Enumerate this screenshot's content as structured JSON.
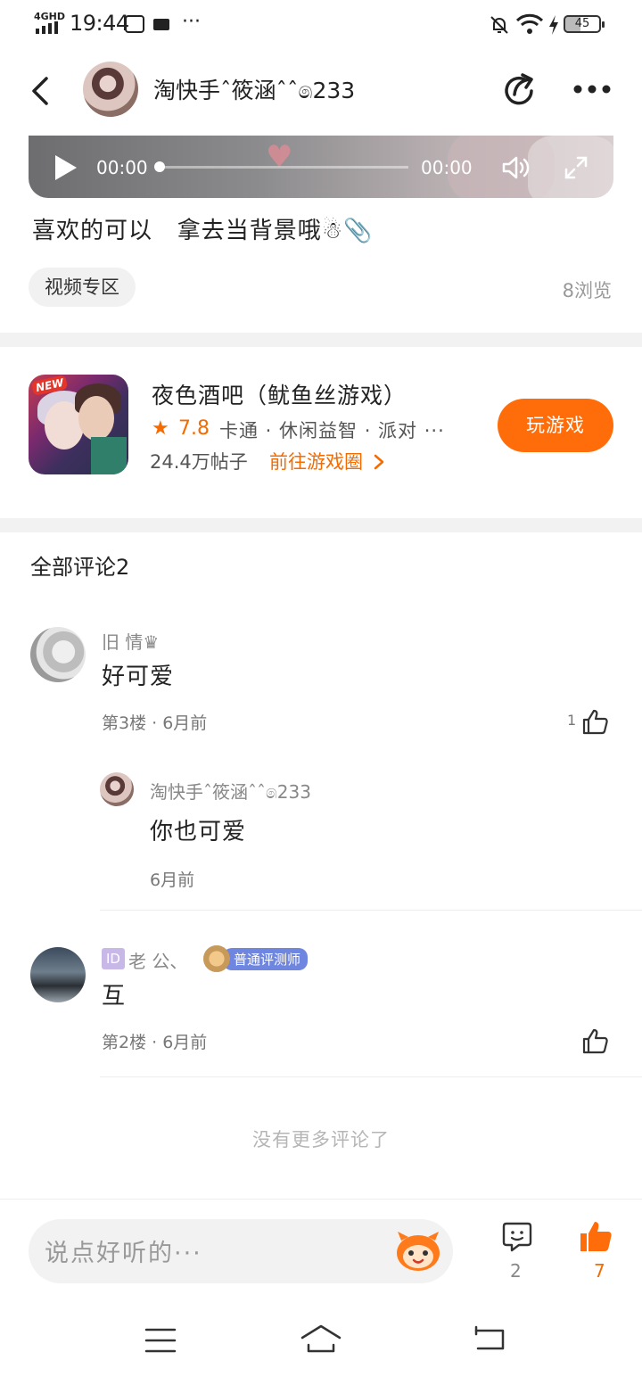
{
  "status_bar": {
    "network": "4GHD",
    "time": "19:44",
    "more": "···",
    "battery": "45"
  },
  "header": {
    "username": "淘快手ˆ筱涵ˆˆ෧233"
  },
  "player": {
    "time_current": "00:00",
    "time_total": "00:00",
    "progress": 0
  },
  "post": {
    "caption": "喜欢的可以   拿去当背景哦☃📎",
    "tag": "视频专区",
    "views": "8浏览"
  },
  "game": {
    "badge": "NEW",
    "title": "夜色酒吧（鱿鱼丝游戏）",
    "rating": "7.8",
    "tags": "卡通 · 休闲益智 · 派对 ···",
    "posts": "24.4万帖子",
    "circle_link": "前往游戏圈",
    "play_button": "玩游戏"
  },
  "comments": {
    "title": "全部评论2",
    "items": [
      {
        "name": "旧  情♛",
        "text": "好可爱",
        "meta": "第3楼 · 6月前",
        "likes": "1",
        "reply": {
          "name": "淘快手ˆ筱涵ˆˆ෧233",
          "text": "你也可爱",
          "meta": "6月前"
        }
      },
      {
        "id_badge": "ID",
        "name": "老   公、",
        "role_badge": "普通评测师",
        "text": "互",
        "meta": "第2楼 · 6月前"
      }
    ],
    "no_more": "没有更多评论了"
  },
  "bottom_bar": {
    "input_placeholder": "说点好听的···",
    "comment_count": "2",
    "like_count": "7"
  },
  "colors": {
    "accent": "#ff6d0a",
    "separator": "#f2f2f2",
    "muted": "#999999"
  },
  "icons": [
    "back-arrow-icon",
    "share-icon",
    "more-dots-icon",
    "play-icon",
    "volume-icon",
    "fullscreen-icon",
    "star-icon",
    "chevron-right-icon",
    "thumb-up-icon",
    "comment-bubble-icon",
    "mascot-icon",
    "menu-icon",
    "home-icon",
    "return-icon"
  ]
}
